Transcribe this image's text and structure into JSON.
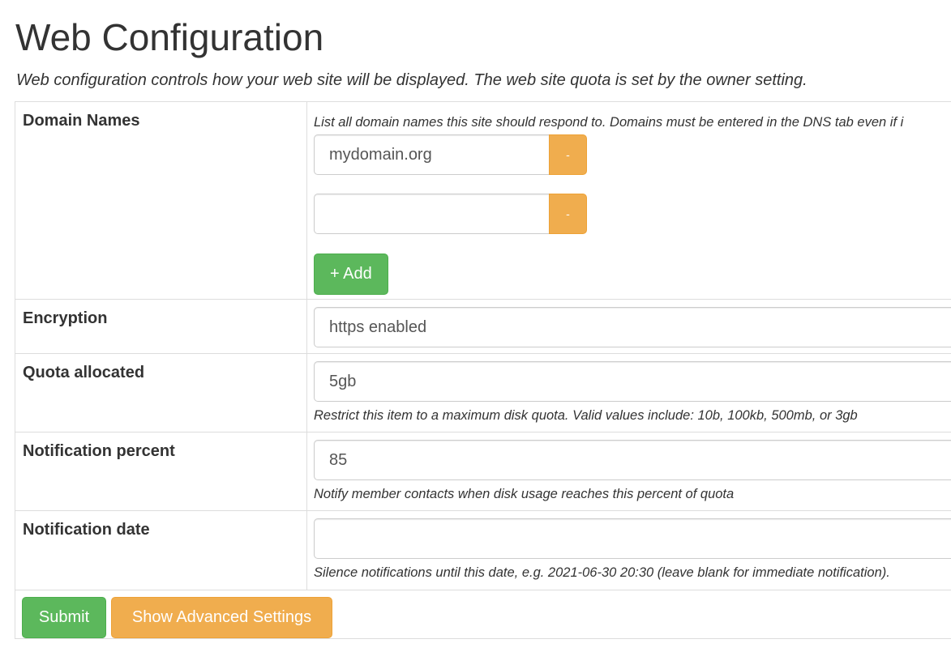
{
  "page": {
    "title": "Web Configuration",
    "subtitle": "Web configuration controls how your web site will be displayed. The web site quota is set by the owner setting."
  },
  "domain_names": {
    "label": "Domain Names",
    "help": "List all domain names this site should respond to. Domains must be entered in the DNS tab even if i",
    "entries": [
      {
        "value": "mydomain.org",
        "remove_label": "-"
      },
      {
        "value": "",
        "remove_label": "-"
      }
    ],
    "add_label": "+ Add"
  },
  "encryption": {
    "label": "Encryption",
    "value": "https enabled"
  },
  "quota": {
    "label": "Quota allocated",
    "value": "5gb",
    "help": "Restrict this item to a maximum disk quota. Valid values include: 10b, 100kb, 500mb, or 3gb"
  },
  "notification_percent": {
    "label": "Notification percent",
    "value": "85",
    "help": "Notify member contacts when disk usage reaches this percent of quota"
  },
  "notification_date": {
    "label": "Notification date",
    "value": "",
    "help": "Silence notifications until this date, e.g. 2021-06-30 20:30 (leave blank for immediate notification)."
  },
  "actions": {
    "submit_label": "Submit",
    "advanced_label": "Show Advanced Settings"
  },
  "colors": {
    "success": "#5cb85c",
    "warning": "#f0ad4e",
    "border": "#dddddd"
  }
}
